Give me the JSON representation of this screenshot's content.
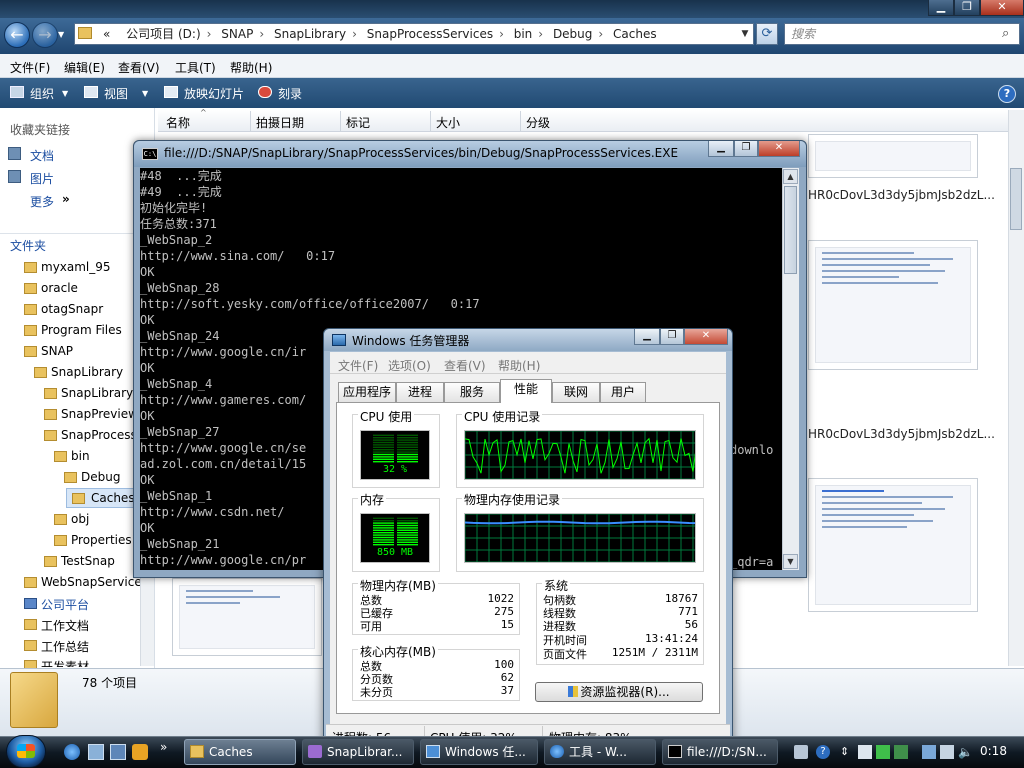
{
  "explorer": {
    "address": [
      "«",
      "公司项目 (D:)",
      "SNAP",
      "SnapLibrary",
      "SnapProcessServices",
      "bin",
      "Debug",
      "Caches"
    ],
    "search_placeholder": "搜索",
    "menu": [
      "文件(F)",
      "编辑(E)",
      "查看(V)",
      "工具(T)",
      "帮助(H)"
    ],
    "toolbar": [
      "组织",
      "视图",
      "放映幻灯片",
      "刻录"
    ],
    "nav": {
      "favorites_header": "收藏夹链接",
      "links": [
        "文档",
        "图片",
        "更多"
      ],
      "folders_header": "文件夹"
    },
    "tree": [
      "myxaml_95",
      "oracle",
      "otagSnapr",
      "Program Files",
      "SNAP",
      "SnapLibrary",
      "SnapLibrary",
      "SnapPreview",
      "SnapProcess",
      "bin",
      "Debug",
      "Caches",
      "obj",
      "Properties",
      "TestSnap",
      "WebSnapService",
      "公司平台",
      "工作文档",
      "工作总结",
      "开发素材"
    ],
    "columns": [
      "名称",
      "拍摄日期",
      "标记",
      "大小",
      "分级"
    ],
    "thumb_labels": [
      "HR0cDovL3d3dy5jbmJsb2dzL...",
      "HR0cDovL3d3dy5jbmJsb2dzL..."
    ],
    "item_count": "78 个项目"
  },
  "console": {
    "title": "file:///D:/SNAP/SnapLibrary/SnapProcessServices/bin/Debug/SnapProcessServices.EXE",
    "lines": [
      "#48  ...完成",
      "#49  ...完成",
      "初始化完毕!",
      "任务总数:371",
      "_WebSnap_2",
      "http://www.sina.com/   0:17",
      "OK",
      "_WebSnap_28",
      "http://soft.yesky.com/office/office2007/   0:17",
      "OK",
      "_WebSnap_24",
      "http://www.google.cn/ir",
      "OK",
      "_WebSnap_4",
      "http://www.gameres.com/",
      "OK",
      "_WebSnap_27",
      "http://www.google.cn/se",
      "ad.zol.com.cn/detail/15",
      "OK",
      "_WebSnap_1",
      "http://www.csdn.net/",
      "OK",
      "_WebSnap_21",
      "http://www.google.cn/pr"
    ],
    "overflow1": "downlo",
    "overflow2": "_qdr=a"
  },
  "taskmgr": {
    "title": "Windows 任务管理器",
    "menu": [
      "文件(F)",
      "选项(O)",
      "查看(V)",
      "帮助(H)"
    ],
    "tabs": [
      "应用程序",
      "进程",
      "服务",
      "性能",
      "联网",
      "用户"
    ],
    "active_tab": "性能",
    "cpu_label": "CPU 使用",
    "cpu_value": "32 %",
    "cpu_percent": 32,
    "cpu_history_label": "CPU 使用记录",
    "mem_label": "内存",
    "mem_value": "850 MB",
    "mem_percent": 83,
    "mem_history_label": "物理内存使用记录",
    "physical": {
      "header": "物理内存(MB)",
      "rows": [
        [
          "总数",
          "1022"
        ],
        [
          "已缓存",
          "275"
        ],
        [
          "可用",
          "15"
        ]
      ]
    },
    "kernel": {
      "header": "核心内存(MB)",
      "rows": [
        [
          "总数",
          "100"
        ],
        [
          "分页数",
          "62"
        ],
        [
          "未分页",
          "37"
        ]
      ]
    },
    "system": {
      "header": "系统",
      "rows": [
        [
          "句柄数",
          "18767"
        ],
        [
          "线程数",
          "771"
        ],
        [
          "进程数",
          "56"
        ],
        [
          "开机时间",
          "13:41:24"
        ],
        [
          "页面文件",
          "1251M / 2311M"
        ]
      ]
    },
    "resmon_button": "资源监视器(R)...",
    "status": [
      "进程数: 56",
      "CPU 使用: 32%",
      "物理内存: 83%"
    ]
  },
  "taskbar": {
    "buttons": [
      "Caches",
      "SnapLibrar...",
      "Windows 任...",
      "工具 - W...",
      "file:///D:/SN..."
    ],
    "clock": "0:18"
  }
}
